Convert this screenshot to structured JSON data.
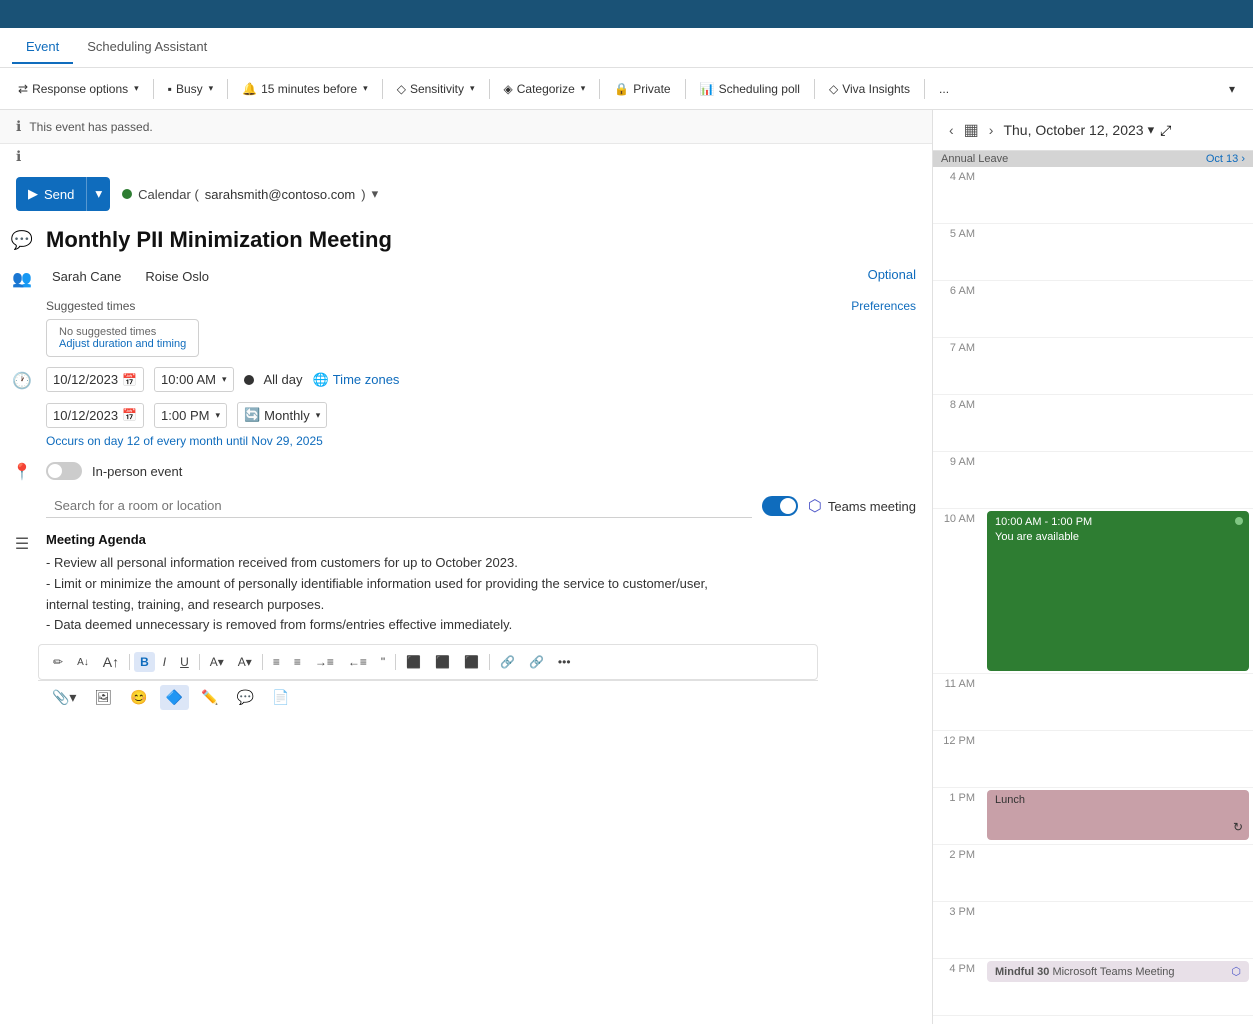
{
  "topbar": {
    "label": ""
  },
  "tabs": [
    {
      "id": "event",
      "label": "Event",
      "active": true
    },
    {
      "id": "scheduling-assistant",
      "label": "Scheduling Assistant",
      "active": false
    }
  ],
  "toolbar": {
    "response_options": "Response options",
    "busy": "Busy",
    "reminder": "15 minutes before",
    "sensitivity": "Sensitivity",
    "categorize": "Categorize",
    "private": "Private",
    "scheduling_poll": "Scheduling poll",
    "viva_insights": "Viva Insights",
    "more": "..."
  },
  "event_passed": {
    "text": "This event has passed."
  },
  "send": {
    "label": "Send"
  },
  "calendar": {
    "label": "Calendar (",
    "email": "sarahsmith@contoso.com",
    "suffix": ")"
  },
  "title": "Monthly PII Minimization Meeting",
  "attendees": {
    "list": [
      "Sarah Cane",
      "Roise Oslo"
    ],
    "optional_label": "Optional"
  },
  "suggested_times": {
    "label": "Suggested times",
    "preferences_label": "Preferences",
    "no_suggested": "No suggested times",
    "adjust_label": "Adjust duration and timing"
  },
  "datetime": {
    "start_date": "10/12/2023",
    "start_time": "10:00 AM",
    "end_date": "10/12/2023",
    "end_time": "1:00 PM",
    "all_day": "All day",
    "timezone_label": "Time zones",
    "recurrence": "Monthly",
    "recurrence_text": "Occurs on day 12 of every month until Nov 29, 2025"
  },
  "location": {
    "toggle_label": "In-person event",
    "search_placeholder": "Search for a room or location",
    "teams_label": "Teams meeting"
  },
  "body": {
    "label": "Meeting Agenda",
    "agenda_lines": [
      "- Review all personal information received from customers for up to October 2023.",
      "- Limit or minimize the amount of personally identifiable information used for providing the service to customer/user,",
      "  internal testing, training, and research purposes.",
      "- Data deemed unnecessary is removed from forms/entries effective immediately."
    ]
  },
  "format_toolbar": {
    "buttons": [
      "✏",
      "A",
      "A",
      "B",
      "I",
      "U",
      "A",
      "A",
      "≡",
      "≡",
      "≡",
      "≡",
      "🔗",
      "🔗",
      "•••"
    ]
  },
  "attach_toolbar": {
    "buttons": [
      "📎",
      "🖼",
      "😊",
      "🔷",
      "✏️",
      "💬",
      "📄"
    ]
  },
  "calendar_nav": {
    "date": "Thu, October 12, 2023"
  },
  "calendar_events": {
    "annual_leave": "Annual Leave",
    "annual_leave_date": "Oct 13",
    "morning_event": {
      "time": "10:00 AM - 1:00 PM",
      "status": "You are available"
    },
    "lunch": "Lunch",
    "afternoon": {
      "name": "Mindful 30",
      "subtitle": "Microsoft Teams Meeting"
    }
  },
  "time_labels": [
    "4 AM",
    "5 AM",
    "6 AM",
    "7 AM",
    "8 AM",
    "9 AM",
    "10 AM",
    "11 AM",
    "12 PM",
    "1 PM",
    "2 PM",
    "3 PM",
    "4 PM"
  ]
}
